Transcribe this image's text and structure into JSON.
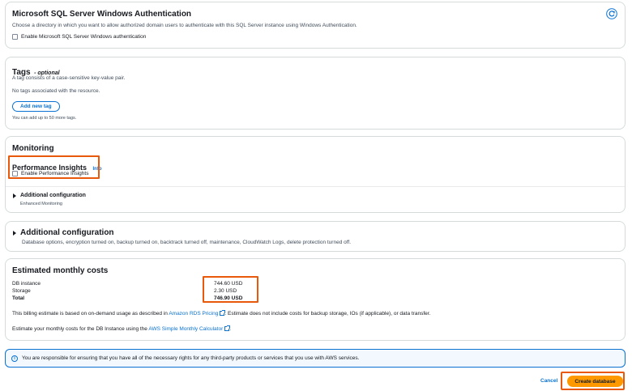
{
  "windows_auth": {
    "title": "Microsoft SQL Server Windows Authentication",
    "description": "Choose a directory in which you want to allow authorized domain users to authenticate with this SQL Server instance using Windows Authentication.",
    "checkbox_label": "Enable Microsoft SQL Server Windows authentication",
    "refresh_icon": "refresh-icon"
  },
  "tags": {
    "title": "Tags",
    "optional": "- optional",
    "description": "A tag consists of a case-sensitive key-value pair.",
    "empty_text": "No tags associated with the resource.",
    "add_button": "Add new tag",
    "limit_text": "You can add up to 50 more tags."
  },
  "monitoring": {
    "title": "Monitoring",
    "pi_title": "Performance Insights",
    "pi_info": "Info",
    "pi_checkbox": "Enable Performance Insights",
    "additional_title": "Additional configuration",
    "additional_sub": "Enhanced Monitoring"
  },
  "additional_config": {
    "title": "Additional configuration",
    "description": "Database options, encryption turned on, backup turned on, backtrack turned off, maintenance, CloudWatch Logs, delete protection turned off."
  },
  "costs": {
    "title": "Estimated monthly costs",
    "rows": [
      {
        "label": "DB instance",
        "value": "744.60 USD"
      },
      {
        "label": "Storage",
        "value": "2.30 USD"
      },
      {
        "label": "Total",
        "value": "746.90 USD"
      }
    ],
    "billing_pre": "This billing estimate is based on on-demand usage as described in ",
    "billing_link": "Amazon RDS Pricing",
    "billing_post": ". Estimate does not include costs for backup storage, IOs (if applicable), or data transfer.",
    "calc_pre": "Estimate your monthly costs for the DB Instance using the ",
    "calc_link": "AWS Simple Monthly Calculator",
    "calc_post": "."
  },
  "notice": {
    "text": "You are responsible for ensuring that you have all of the necessary rights for any third-party products or services that you use with AWS services.",
    "icon": "info-icon"
  },
  "footer": {
    "cancel": "Cancel",
    "create": "Create database"
  },
  "colors": {
    "accent": "#0972d3",
    "primary_button": "#ff9900",
    "highlight": "#e8590c",
    "notice_bg": "#f2f8fd"
  }
}
